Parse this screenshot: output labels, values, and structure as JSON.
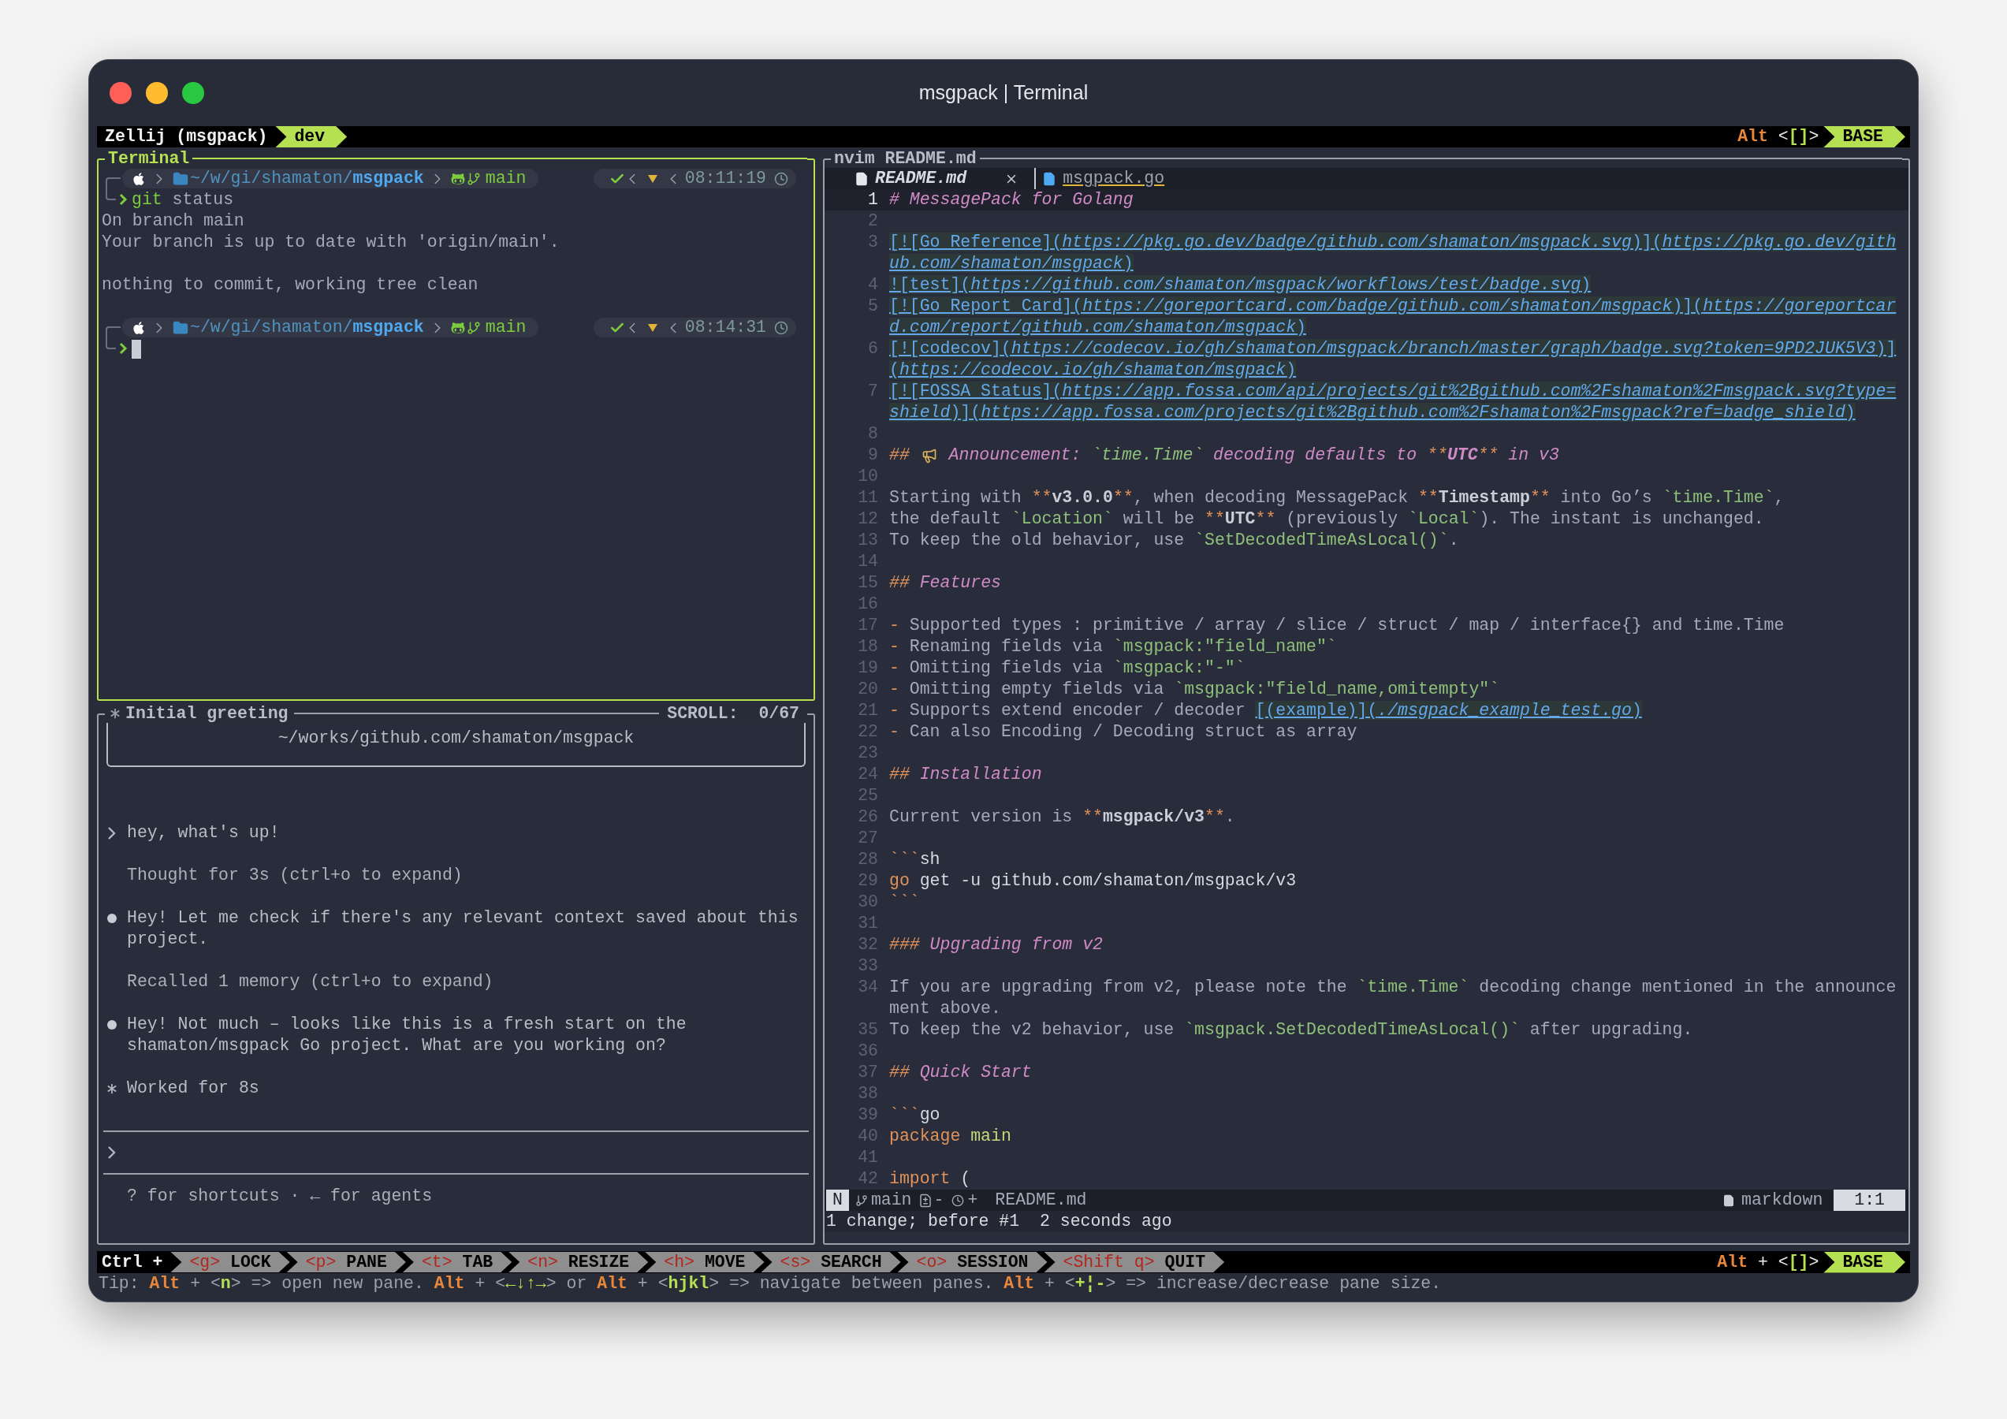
{
  "window": {
    "title": "msgpack | Terminal"
  },
  "top_bar": {
    "session": "Zellij (msgpack)",
    "tab": "dev",
    "shortcut": [
      {
        "kind": "alt",
        "text": "Alt"
      },
      {
        "kind": "white",
        "text": " <"
      },
      {
        "kind": "key",
        "text": "[]"
      },
      {
        "kind": "white",
        "text": ">"
      }
    ],
    "mode": "BASE"
  },
  "terminal_pane": {
    "title": "Terminal",
    "focused": true,
    "sessions": [
      {
        "path_prefix": "~/w/gi/shamaton/",
        "path_dir": "msgpack",
        "branch": "main",
        "time": "08:11:19",
        "command": "git",
        "args": " status",
        "cursor": false,
        "output": [
          [
            "On branch main",
            "Your branch is up to date with 'origin/main'."
          ],
          [
            "nothing to commit, working tree clean"
          ]
        ]
      },
      {
        "path_prefix": "~/w/gi/shamaton/",
        "path_dir": "msgpack",
        "branch": "main",
        "time": "08:14:31",
        "cursor": true
      }
    ]
  },
  "agent_pane": {
    "title": "Initial greeting",
    "scroll": "SCROLL:  0/67",
    "focused": false,
    "directory": "~/works/github.com/shamaton/msgpack",
    "messages": [
      {
        "kind": "user",
        "text": "hey, what's up!"
      },
      {
        "kind": "note",
        "text": "Thought for 3s (ctrl+o to expand)"
      },
      {
        "kind": "assistant",
        "text": "Hey! Let me check if there's any relevant context saved about this project."
      },
      {
        "kind": "note",
        "text": "Recalled 1 memory (ctrl+o to expand)"
      },
      {
        "kind": "assistant",
        "text": "Hey! Not much – looks like this is a fresh start on the shamaton/msgpack Go project. What are you working on?"
      },
      {
        "kind": "status",
        "text": "Worked for 8s"
      }
    ],
    "footer": "? for shortcuts · ← for agents"
  },
  "editor_pane": {
    "title": "nvim README.md",
    "focused": false,
    "tabs": [
      {
        "label": "README.md",
        "selected": true
      },
      {
        "label": "msgpack.go",
        "selected": false
      }
    ],
    "lines": [
      {
        "number": "1",
        "current": true,
        "segments": [
          {
            "kind": "heading",
            "text": "# MessagePack for Golang"
          }
        ]
      },
      {
        "number": "2",
        "current": false
      },
      {
        "number": "3",
        "current": false,
        "segments": [
          {
            "kind": "link",
            "text": "[![Go Reference]("
          },
          {
            "kind": "url",
            "text": "https://pkg.go.dev/badge/github.com/shamaton/msgpack.svg"
          },
          {
            "kind": "link",
            "text": ")]("
          },
          {
            "kind": "url",
            "text": "https://pkg.go.dev/gith"
          },
          {
            "kind": "break"
          },
          {
            "kind": "url",
            "text": "ub.com/shamaton/msgpack"
          },
          {
            "kind": "link",
            "text": ")"
          }
        ]
      },
      {
        "number": "4",
        "current": false,
        "segments": [
          {
            "kind": "link",
            "text": "![test]("
          },
          {
            "kind": "url",
            "text": "https://github.com/shamaton/msgpack/workflows/test/badge.svg"
          },
          {
            "kind": "link",
            "text": ")"
          }
        ]
      },
      {
        "number": "5",
        "current": false,
        "segments": [
          {
            "kind": "link",
            "text": "[![Go Report Card]("
          },
          {
            "kind": "url",
            "text": "https://goreportcard.com/badge/github.com/shamaton/msgpack"
          },
          {
            "kind": "link",
            "text": ")]("
          },
          {
            "kind": "url",
            "text": "https://goreportcar"
          },
          {
            "kind": "break"
          },
          {
            "kind": "url",
            "text": "d.com/report/github.com/shamaton/msgpack"
          },
          {
            "kind": "link",
            "text": ")"
          }
        ]
      },
      {
        "number": "6",
        "current": false,
        "segments": [
          {
            "kind": "link",
            "text": "[![codecov]("
          },
          {
            "kind": "url",
            "text": "https://codecov.io/gh/shamaton/msgpack/branch/master/graph/badge.svg?token=9PD2JUK5V3"
          },
          {
            "kind": "link",
            "text": ")]"
          },
          {
            "kind": "break"
          },
          {
            "kind": "link",
            "text": "("
          },
          {
            "kind": "url",
            "text": "https://codecov.io/gh/shamaton/msgpack"
          },
          {
            "kind": "link",
            "text": ")"
          }
        ]
      },
      {
        "number": "7",
        "current": false,
        "segments": [
          {
            "kind": "link",
            "text": "[![FOSSA Status]("
          },
          {
            "kind": "url",
            "text": "https://app.fossa.com/api/projects/git%2Bgithub.com%2Fshamaton%2Fmsgpack.svg?type="
          },
          {
            "kind": "break"
          },
          {
            "kind": "url",
            "text": "shield"
          },
          {
            "kind": "link",
            "text": ")]("
          },
          {
            "kind": "url",
            "text": "https://app.fossa.com/projects/git%2Bgithub.com%2Fshamaton%2Fmsgpack?ref=badge_shield"
          },
          {
            "kind": "link",
            "text": ")"
          }
        ]
      },
      {
        "number": "8",
        "current": false
      },
      {
        "number": "9",
        "current": false,
        "segments": [
          {
            "kind": "hmark",
            "text": "## "
          },
          {
            "kind": "megaphone"
          },
          {
            "kind": "heading",
            "text": " Announcement: "
          },
          {
            "kind": "hcode",
            "text": "`time.Time`"
          },
          {
            "kind": "heading",
            "text": " decoding defaults to "
          },
          {
            "kind": "hmark",
            "text": "**"
          },
          {
            "kind": "hbold",
            "text": "UTC"
          },
          {
            "kind": "hmark",
            "text": "**"
          },
          {
            "kind": "heading",
            "text": " in v3"
          }
        ]
      },
      {
        "number": "10",
        "current": false
      },
      {
        "number": "11",
        "current": false,
        "segments": [
          {
            "kind": "text",
            "text": "Starting with "
          },
          {
            "kind": "mark",
            "text": "**"
          },
          {
            "kind": "bold",
            "text": "v3.0.0"
          },
          {
            "kind": "mark",
            "text": "**"
          },
          {
            "kind": "text",
            "text": ", when decoding MessagePack "
          },
          {
            "kind": "mark",
            "text": "**"
          },
          {
            "kind": "bold",
            "text": "Timestamp"
          },
          {
            "kind": "mark",
            "text": "**"
          },
          {
            "kind": "text",
            "text": " into Go’s "
          },
          {
            "kind": "code",
            "text": "`time.Time`"
          },
          {
            "kind": "text",
            "text": ","
          }
        ]
      },
      {
        "number": "12",
        "current": false,
        "segments": [
          {
            "kind": "text",
            "text": "the default "
          },
          {
            "kind": "code",
            "text": "`Location`"
          },
          {
            "kind": "text",
            "text": " will be "
          },
          {
            "kind": "mark",
            "text": "**"
          },
          {
            "kind": "bold",
            "text": "UTC"
          },
          {
            "kind": "mark",
            "text": "**"
          },
          {
            "kind": "text",
            "text": " (previously "
          },
          {
            "kind": "code",
            "text": "`Local`"
          },
          {
            "kind": "text",
            "text": "). The instant is unchanged."
          }
        ]
      },
      {
        "number": "13",
        "current": false,
        "segments": [
          {
            "kind": "text",
            "text": "To keep the old behavior, use "
          },
          {
            "kind": "code",
            "text": "`SetDecodedTimeAsLocal()`"
          },
          {
            "kind": "text",
            "text": "."
          }
        ]
      },
      {
        "number": "14",
        "current": false
      },
      {
        "number": "15",
        "current": false,
        "segments": [
          {
            "kind": "hmark",
            "text": "## "
          },
          {
            "kind": "heading",
            "text": "Features"
          }
        ]
      },
      {
        "number": "16",
        "current": false
      },
      {
        "number": "17",
        "current": false,
        "segments": [
          {
            "kind": "mark",
            "text": "-"
          },
          {
            "kind": "text",
            "text": " Supported types : primitive / array / slice / struct / map / interface{} and time.Time"
          }
        ]
      },
      {
        "number": "18",
        "current": false,
        "segments": [
          {
            "kind": "mark",
            "text": "-"
          },
          {
            "kind": "text",
            "text": " Renaming fields via "
          },
          {
            "kind": "code",
            "text": "`msgpack:\"field_name\"`"
          }
        ]
      },
      {
        "number": "19",
        "current": false,
        "segments": [
          {
            "kind": "mark",
            "text": "-"
          },
          {
            "kind": "text",
            "text": " Omitting fields via "
          },
          {
            "kind": "code",
            "text": "`msgpack:\"-\"`"
          }
        ]
      },
      {
        "number": "20",
        "current": false,
        "segments": [
          {
            "kind": "mark",
            "text": "-"
          },
          {
            "kind": "text",
            "text": " Omitting empty fields via "
          },
          {
            "kind": "code",
            "text": "`msgpack:\"field_name,omitempty\"`"
          }
        ]
      },
      {
        "number": "21",
        "current": false,
        "segments": [
          {
            "kind": "mark",
            "text": "-"
          },
          {
            "kind": "text",
            "text": " Supports extend encoder / decoder "
          },
          {
            "kind": "link",
            "text": "[(example)]("
          },
          {
            "kind": "url",
            "text": "./msgpack_example_test.go"
          },
          {
            "kind": "link",
            "text": ")"
          }
        ]
      },
      {
        "number": "22",
        "current": false,
        "segments": [
          {
            "kind": "mark",
            "text": "-"
          },
          {
            "kind": "text",
            "text": " Can also Encoding / Decoding struct as array"
          }
        ]
      },
      {
        "number": "23",
        "current": false
      },
      {
        "number": "24",
        "current": false,
        "segments": [
          {
            "kind": "hmark",
            "text": "## "
          },
          {
            "kind": "heading",
            "text": "Installation"
          }
        ]
      },
      {
        "number": "25",
        "current": false
      },
      {
        "number": "26",
        "current": false,
        "segments": [
          {
            "kind": "text",
            "text": "Current version is "
          },
          {
            "kind": "mark",
            "text": "**"
          },
          {
            "kind": "bold",
            "text": "msgpack/v3"
          },
          {
            "kind": "mark",
            "text": "**"
          },
          {
            "kind": "text",
            "text": "."
          }
        ]
      },
      {
        "number": "27",
        "current": false
      },
      {
        "number": "28",
        "current": false,
        "segments": [
          {
            "kind": "mark",
            "text": "```"
          },
          {
            "kind": "plain",
            "text": "sh"
          }
        ]
      },
      {
        "number": "29",
        "current": false,
        "segments": [
          {
            "kind": "keyword",
            "text": "go"
          },
          {
            "kind": "plain",
            "text": " get -u github.com/shamaton/msgpack/v3"
          }
        ]
      },
      {
        "number": "30",
        "current": false,
        "segments": [
          {
            "kind": "mark",
            "text": "```"
          }
        ]
      },
      {
        "number": "31",
        "current": false
      },
      {
        "number": "32",
        "current": false,
        "segments": [
          {
            "kind": "hmark",
            "text": "### "
          },
          {
            "kind": "heading",
            "text": "Upgrading from v2"
          }
        ]
      },
      {
        "number": "33",
        "current": false
      },
      {
        "number": "34",
        "current": false,
        "segments": [
          {
            "kind": "text",
            "text": "If you are upgrading from v2, please note the "
          },
          {
            "kind": "code",
            "text": "`time.Time`"
          },
          {
            "kind": "text",
            "text": " decoding change mentioned in the announce"
          },
          {
            "kind": "break"
          },
          {
            "kind": "text",
            "text": "ment above."
          }
        ]
      },
      {
        "number": "35",
        "current": false,
        "segments": [
          {
            "kind": "text",
            "text": "To keep the v2 behavior, use "
          },
          {
            "kind": "code",
            "text": "`msgpack.SetDecodedTimeAsLocal()`"
          },
          {
            "kind": "text",
            "text": " after upgrading."
          }
        ]
      },
      {
        "number": "36",
        "current": false
      },
      {
        "number": "37",
        "current": false,
        "segments": [
          {
            "kind": "hmark",
            "text": "## "
          },
          {
            "kind": "heading",
            "text": "Quick Start"
          }
        ]
      },
      {
        "number": "38",
        "current": false
      },
      {
        "number": "39",
        "current": false,
        "segments": [
          {
            "kind": "mark",
            "text": "```"
          },
          {
            "kind": "plain",
            "text": "go"
          }
        ]
      },
      {
        "number": "40",
        "current": false,
        "segments": [
          {
            "kind": "keyword",
            "text": "package "
          },
          {
            "kind": "ident",
            "text": "main"
          }
        ]
      },
      {
        "number": "41",
        "current": false
      },
      {
        "number": "42",
        "current": false,
        "segments": [
          {
            "kind": "keyword",
            "text": "import"
          },
          {
            "kind": "plain",
            "text": " ("
          }
        ]
      }
    ],
    "statusline": {
      "mode": "N",
      "branch": "main",
      "diff": "-",
      "history": "+",
      "file": "README.md",
      "filetype": "markdown",
      "position": "1:1"
    },
    "message": "1 change; before #1  2 seconds ago"
  },
  "bottom_bar": {
    "modifier": "Ctrl +",
    "items": [
      {
        "key": "<g>",
        "label": "LOCK"
      },
      {
        "key": "<p>",
        "label": "PANE"
      },
      {
        "key": "<t>",
        "label": "TAB"
      },
      {
        "key": "<n>",
        "label": "RESIZE"
      },
      {
        "key": "<h>",
        "label": "MOVE"
      },
      {
        "key": "<s>",
        "label": "SEARCH"
      },
      {
        "key": "<o>",
        "label": "SESSION"
      },
      {
        "key": "<Shift q>",
        "label": "QUIT"
      }
    ],
    "shortcut": [
      {
        "kind": "alt",
        "text": "Alt"
      },
      {
        "kind": "white",
        "text": " + <"
      },
      {
        "kind": "key",
        "text": "[]"
      },
      {
        "kind": "white",
        "text": ">"
      }
    ],
    "mode": "BASE"
  },
  "tip": [
    {
      "kind": "dim",
      "text": "Tip: "
    },
    {
      "kind": "alt",
      "text": "Alt"
    },
    {
      "kind": "dim",
      "text": " + <"
    },
    {
      "kind": "key",
      "text": "n"
    },
    {
      "kind": "dim",
      "text": "> => open new pane. "
    },
    {
      "kind": "alt",
      "text": "Alt"
    },
    {
      "kind": "dim",
      "text": " + <"
    },
    {
      "kind": "key",
      "text": "←↓↑→"
    },
    {
      "kind": "dim",
      "text": "> or "
    },
    {
      "kind": "alt",
      "text": "Alt"
    },
    {
      "kind": "dim",
      "text": " + <"
    },
    {
      "kind": "key",
      "text": "hjkl"
    },
    {
      "kind": "dim",
      "text": "> => navigate between panes. "
    },
    {
      "kind": "alt",
      "text": "Alt"
    },
    {
      "kind": "dim",
      "text": " + <"
    },
    {
      "kind": "key",
      "text": "+¦-"
    },
    {
      "kind": "dim",
      "text": "> => increase/decrease pane size."
    }
  ]
}
